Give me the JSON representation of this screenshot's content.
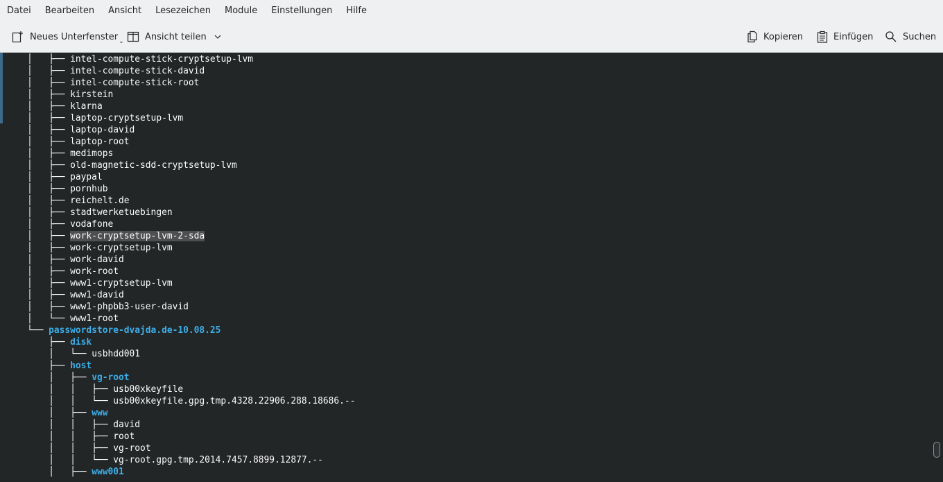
{
  "menu": [
    "Datei",
    "Bearbeiten",
    "Ansicht",
    "Lesezeichen",
    "Module",
    "Einstellungen",
    "Hilfe"
  ],
  "toolbar": {
    "new_tab_label": "Neues Unterfenster",
    "split_view_label": "Ansicht teilen",
    "copy_label": "Kopieren",
    "paste_label": "Einfügen",
    "search_label": "Suchen"
  },
  "terminal": {
    "lines": [
      {
        "prefix": "    │   ├── ",
        "name": "intel-compute-stick-cryptsetup-lvm",
        "dir": false
      },
      {
        "prefix": "    │   ├── ",
        "name": "intel-compute-stick-david",
        "dir": false
      },
      {
        "prefix": "    │   ├── ",
        "name": "intel-compute-stick-root",
        "dir": false
      },
      {
        "prefix": "    │   ├── ",
        "name": "kirstein",
        "dir": false
      },
      {
        "prefix": "    │   ├── ",
        "name": "klarna",
        "dir": false
      },
      {
        "prefix": "    │   ├── ",
        "name": "laptop-cryptsetup-lvm",
        "dir": false
      },
      {
        "prefix": "    │   ├── ",
        "name": "laptop-david",
        "dir": false
      },
      {
        "prefix": "    │   ├── ",
        "name": "laptop-root",
        "dir": false
      },
      {
        "prefix": "    │   ├── ",
        "name": "medimops",
        "dir": false
      },
      {
        "prefix": "    │   ├── ",
        "name": "old-magnetic-sdd-cryptsetup-lvm",
        "dir": false
      },
      {
        "prefix": "    │   ├── ",
        "name": "paypal",
        "dir": false
      },
      {
        "prefix": "    │   ├── ",
        "name": "pornhub",
        "dir": false
      },
      {
        "prefix": "    │   ├── ",
        "name": "reichelt.de",
        "dir": false
      },
      {
        "prefix": "    │   ├── ",
        "name": "stadtwerketuebingen",
        "dir": false
      },
      {
        "prefix": "    │   ├── ",
        "name": "vodafone",
        "dir": false
      },
      {
        "prefix": "    │   ├── ",
        "name": "work-cryptsetup-lvm-2-sda",
        "dir": false,
        "selected": true
      },
      {
        "prefix": "    │   ├── ",
        "name": "work-cryptsetup-lvm",
        "dir": false
      },
      {
        "prefix": "    │   ├── ",
        "name": "work-david",
        "dir": false
      },
      {
        "prefix": "    │   ├── ",
        "name": "work-root",
        "dir": false
      },
      {
        "prefix": "    │   ├── ",
        "name": "www1-cryptsetup-lvm",
        "dir": false
      },
      {
        "prefix": "    │   ├── ",
        "name": "www1-david",
        "dir": false
      },
      {
        "prefix": "    │   ├── ",
        "name": "www1-phpbb3-user-david",
        "dir": false
      },
      {
        "prefix": "    │   └── ",
        "name": "www1-root",
        "dir": false
      },
      {
        "prefix": "    └── ",
        "name": "passwordstore-dvajda.de-10.08.25",
        "dir": true
      },
      {
        "prefix": "        ├── ",
        "name": "disk",
        "dir": true
      },
      {
        "prefix": "        │   └── ",
        "name": "usbhdd001",
        "dir": false
      },
      {
        "prefix": "        ├── ",
        "name": "host",
        "dir": true
      },
      {
        "prefix": "        │   ├── ",
        "name": "vg-root",
        "dir": true
      },
      {
        "prefix": "        │   │   ├── ",
        "name": "usb00xkeyfile",
        "dir": false
      },
      {
        "prefix": "        │   │   └── ",
        "name": "usb00xkeyfile.gpg.tmp.4328.22906.288.18686.--",
        "dir": false
      },
      {
        "prefix": "        │   ├── ",
        "name": "www",
        "dir": true
      },
      {
        "prefix": "        │   │   ├── ",
        "name": "david",
        "dir": false
      },
      {
        "prefix": "        │   │   ├── ",
        "name": "root",
        "dir": false
      },
      {
        "prefix": "        │   │   ├── ",
        "name": "vg-root",
        "dir": false
      },
      {
        "prefix": "        │   │   └── ",
        "name": "vg-root.gpg.tmp.2014.7457.8899.12877.--",
        "dir": false
      },
      {
        "prefix": "        │   ├── ",
        "name": "www001",
        "dir": true
      }
    ]
  },
  "colors": {
    "terminal_bg": "#232627",
    "dir_color": "#3daee9",
    "text": "#fcfcfc",
    "toolbar_bg": "#eff0f1"
  },
  "icons": {
    "new_tab": "new-tab-icon",
    "split_view": "split-view-icon",
    "copy": "copy-icon",
    "paste": "paste-icon",
    "search": "search-icon"
  }
}
